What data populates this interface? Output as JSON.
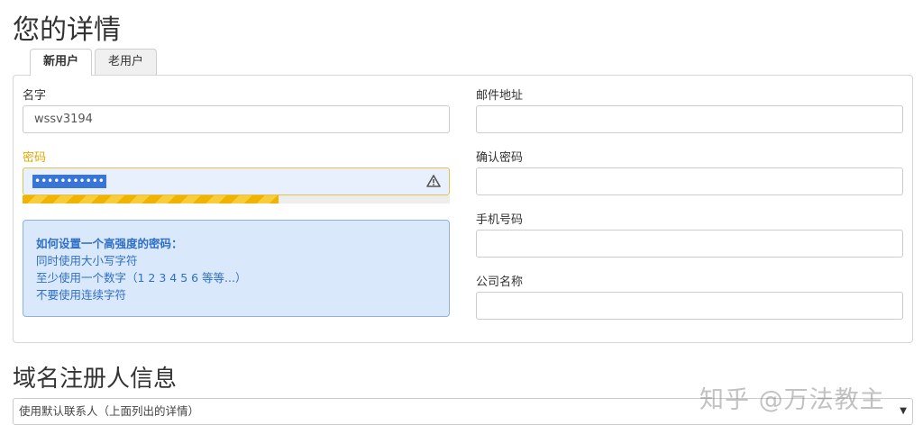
{
  "page_title": "您的详情",
  "tabs": [
    {
      "label": "新用户",
      "active": true
    },
    {
      "label": "老用户",
      "active": false
    }
  ],
  "form": {
    "name": {
      "label": "名字",
      "value": "wssv3194"
    },
    "password": {
      "label": "密码",
      "value_masked": "•••••••••••",
      "strength_fraction": 0.6
    },
    "email": {
      "label": "邮件地址",
      "value": ""
    },
    "confirm_password": {
      "label": "确认密码",
      "value": ""
    },
    "phone": {
      "label": "手机号码",
      "value": ""
    },
    "company": {
      "label": "公司名称",
      "value": ""
    }
  },
  "help": {
    "title": "如何设置一个高强度的密码：",
    "lines": [
      "同时使用大小写字符",
      "至少使用一个数字（1 2 3 4 5 6 等等...）",
      "不要使用连续字符"
    ]
  },
  "registrant": {
    "section_title": "域名注册人信息",
    "select_value": "使用默认联系人（上面列出的详情）"
  },
  "watermark": "知乎 @万法教主",
  "colors": {
    "warning": "#e0a800",
    "help_bg": "#d9e8fb",
    "help_text": "#2f6fc7",
    "strength": "#f0b400"
  }
}
